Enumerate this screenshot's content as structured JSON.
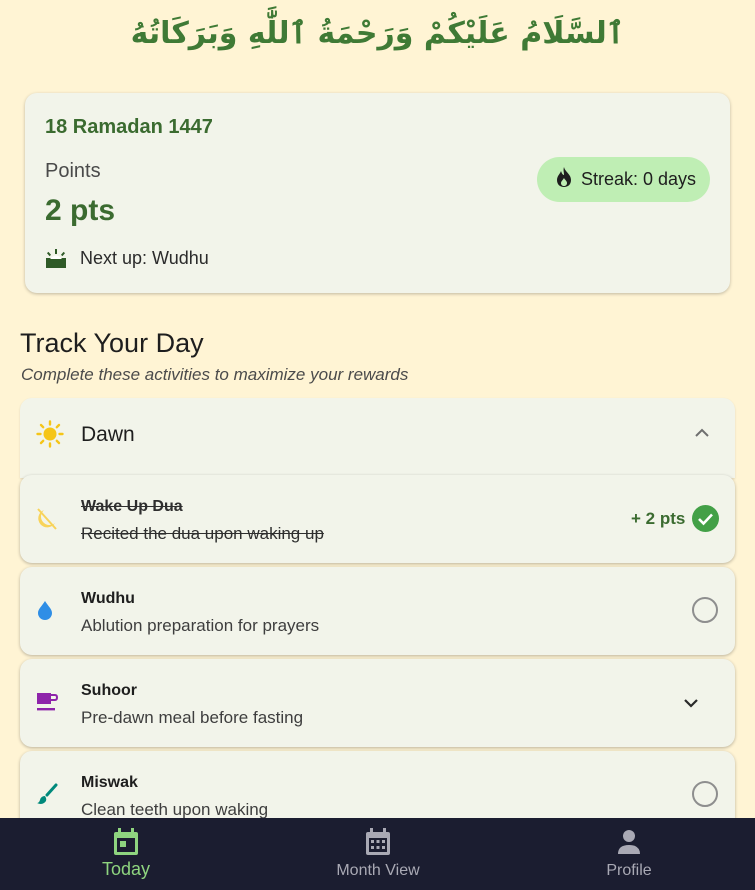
{
  "greeting": "ٱلسَّلَامُ عَلَيْكُمْ وَرَحْمَةُ ٱللَّٰهِ وَبَرَكَاتُهُ",
  "summary": {
    "hijri_date": "18 Ramadan 1447",
    "points_label": "Points",
    "points_value": "2 pts",
    "next_up": "Next up: Wudhu",
    "streak": "Streak: 0 days"
  },
  "track": {
    "title": "Track Your Day",
    "subtitle": "Complete these activities to maximize your rewards"
  },
  "dawn": {
    "title": "Dawn",
    "activities": [
      {
        "title": "Wake Up Dua",
        "desc": "Recited the dua upon waking up",
        "points": "+ 2 pts",
        "completed": true,
        "icon": "moon-crescent-icon"
      },
      {
        "title": "Wudhu",
        "desc": "Ablution preparation for prayers",
        "completed": false,
        "icon": "water-drop-icon"
      },
      {
        "title": "Suhoor",
        "desc": "Pre-dawn meal before fasting",
        "expandable": true,
        "icon": "cup-icon"
      },
      {
        "title": "Miswak",
        "desc": "Clean teeth upon waking",
        "completed": false,
        "icon": "brush-icon"
      }
    ]
  },
  "nav": [
    {
      "label": "Today",
      "icon": "calendar-today-icon",
      "active": true
    },
    {
      "label": "Month View",
      "icon": "calendar-month-icon",
      "active": false
    },
    {
      "label": "Profile",
      "icon": "person-icon",
      "active": false
    }
  ],
  "colors": {
    "background": "#fff4d4",
    "card": "#f2f4ea",
    "primary_green": "#3b6b30",
    "streak_chip": "#bfeeb4",
    "nav_bg": "#1b1d30",
    "nav_active": "#8ed47f"
  }
}
